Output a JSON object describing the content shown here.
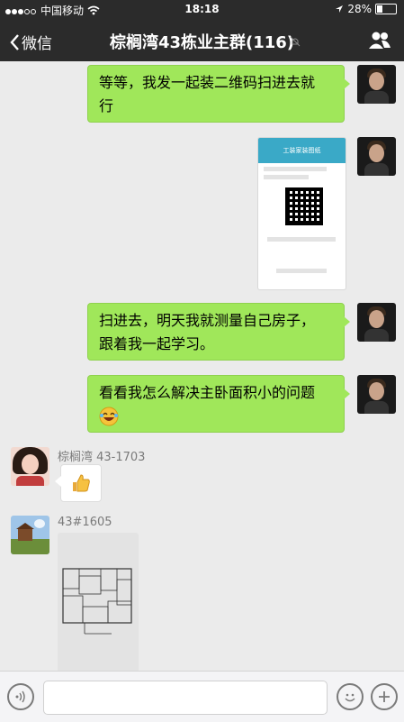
{
  "status_bar": {
    "carrier": "中国移动",
    "time": "18:18",
    "battery": "28%"
  },
  "nav": {
    "back_label": "微信",
    "title": "棕榈湾43栋业主群(116)"
  },
  "messages": [
    {
      "type": "text",
      "text_lines": [
        "等等，我发一起装二维码扫进去就",
        "行"
      ]
    },
    {
      "type": "image",
      "caption": "工装家装图纸"
    },
    {
      "type": "text",
      "text_lines": [
        "扫进去，明天我就测量自己房子，",
        "跟着我一起学习。"
      ]
    },
    {
      "type": "text",
      "text_lines": [
        "看看我怎么解决主卧面积小的问题",
        ""
      ]
    },
    {
      "type": "emoji",
      "sender": "棕榈湾 43-1703"
    },
    {
      "type": "image",
      "sender": "43#1605"
    }
  ],
  "input": {
    "placeholder": ""
  },
  "colors": {
    "bar": "#2b2b2b",
    "bubble_green": "#a0e75a",
    "background": "#ebebeb"
  }
}
